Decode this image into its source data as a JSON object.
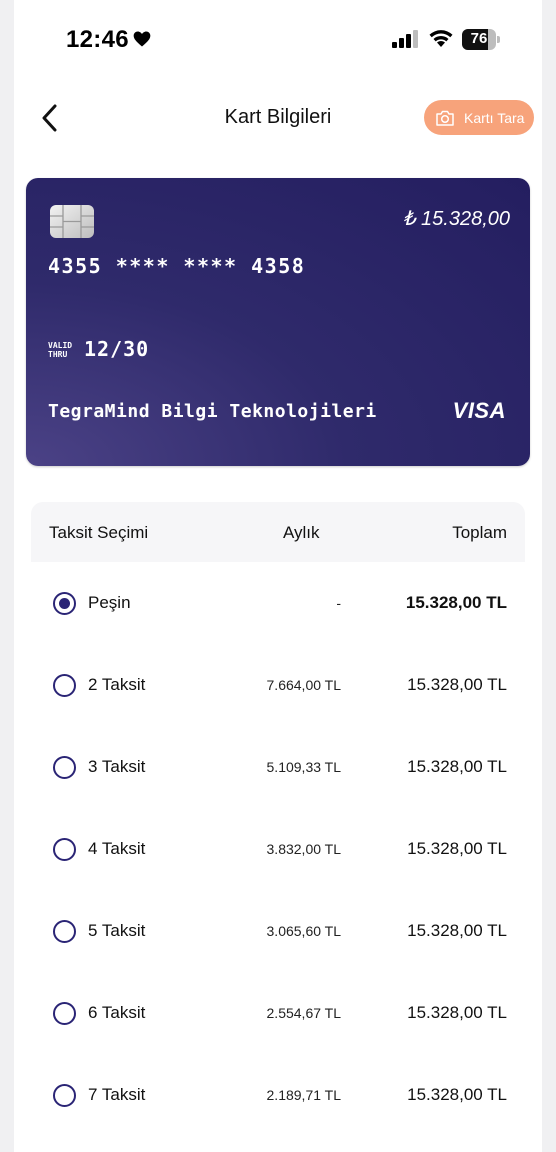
{
  "status_bar": {
    "time": "12:46",
    "battery_level": 76,
    "battery_label": "76"
  },
  "header": {
    "title": "Kart Bilgileri",
    "scan_button_label": "Kartı Tara"
  },
  "card": {
    "amount": "₺ 15.328,00",
    "number": "4355 **** **** 4358",
    "valid_thru_label_1": "VALID",
    "valid_thru_label_2": "THRU",
    "expiry": "12/30",
    "holder": "TegraMind Bilgi Teknolojileri",
    "brand": "VISA",
    "colors": {
      "card_bg": "#2f2a6b",
      "accent": "#f7a37b"
    }
  },
  "installments": {
    "headers": {
      "option": "Taksit Seçimi",
      "monthly": "Aylık",
      "total": "Toplam"
    },
    "rows": [
      {
        "label": "Peşin",
        "monthly": "-",
        "total": "15.328,00 TL",
        "selected": true
      },
      {
        "label": "2 Taksit",
        "monthly": "7.664,00 TL",
        "total": "15.328,00 TL",
        "selected": false
      },
      {
        "label": "3 Taksit",
        "monthly": "5.109,33 TL",
        "total": "15.328,00 TL",
        "selected": false
      },
      {
        "label": "4 Taksit",
        "monthly": "3.832,00 TL",
        "total": "15.328,00 TL",
        "selected": false
      },
      {
        "label": "5 Taksit",
        "monthly": "3.065,60 TL",
        "total": "15.328,00 TL",
        "selected": false
      },
      {
        "label": "6 Taksit",
        "monthly": "2.554,67 TL",
        "total": "15.328,00 TL",
        "selected": false
      },
      {
        "label": "7 Taksit",
        "monthly": "2.189,71 TL",
        "total": "15.328,00 TL",
        "selected": false
      }
    ]
  }
}
